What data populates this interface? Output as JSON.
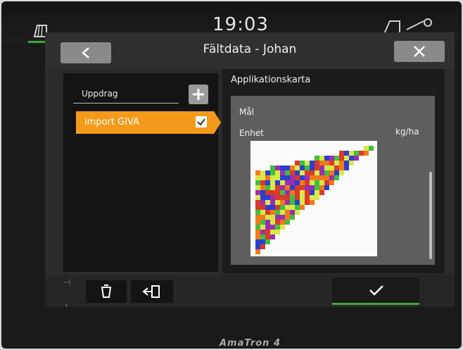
{
  "status": {
    "clock": "19:03"
  },
  "header": {
    "title": "Fältdata - Johan",
    "back_icon": "chevron-left-icon",
    "close_icon": "close-icon"
  },
  "orders": {
    "label": "Uppdrag",
    "add_icon": "plus-icon",
    "items": [
      {
        "label": "import GIVA",
        "checked": true
      }
    ]
  },
  "application_map": {
    "title": "Applikationskarta",
    "target_label": "Mål",
    "unit_label": "Enhet",
    "unit_value": "kg/ha",
    "map_colors": [
      "#d93a2a",
      "#2a3fd0",
      "#d8e84a",
      "#3fbf3f",
      "#9c2fb0",
      "#f07a1a"
    ]
  },
  "toolbar": {
    "delete_icon": "trash-icon",
    "export_icon": "export-icon",
    "confirm_icon": "checkmark-icon"
  },
  "brand": {
    "name": "AmaTron 4"
  },
  "colors": {
    "accent": "#f39a1a",
    "green": "#3fa63a"
  }
}
